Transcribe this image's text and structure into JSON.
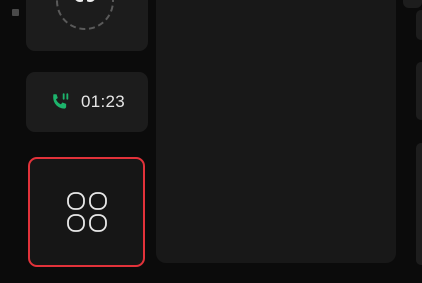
{
  "status": {
    "indicator_icon": "status-square-icon"
  },
  "media_tile": {
    "icon": "cd-disc-icon",
    "ring": "progress-ring"
  },
  "call_tile": {
    "icon": "phone-call-icon",
    "timer": "01:23",
    "accent_color": "#1db46c"
  },
  "apps_tile": {
    "icon": "app-grid-icon",
    "selected": true,
    "highlight_color": "#e2323a"
  },
  "colors": {
    "background": "#0b0b0b",
    "tile": "#1c1c1c",
    "panel": "#181818",
    "text": "#e6e6e6"
  }
}
